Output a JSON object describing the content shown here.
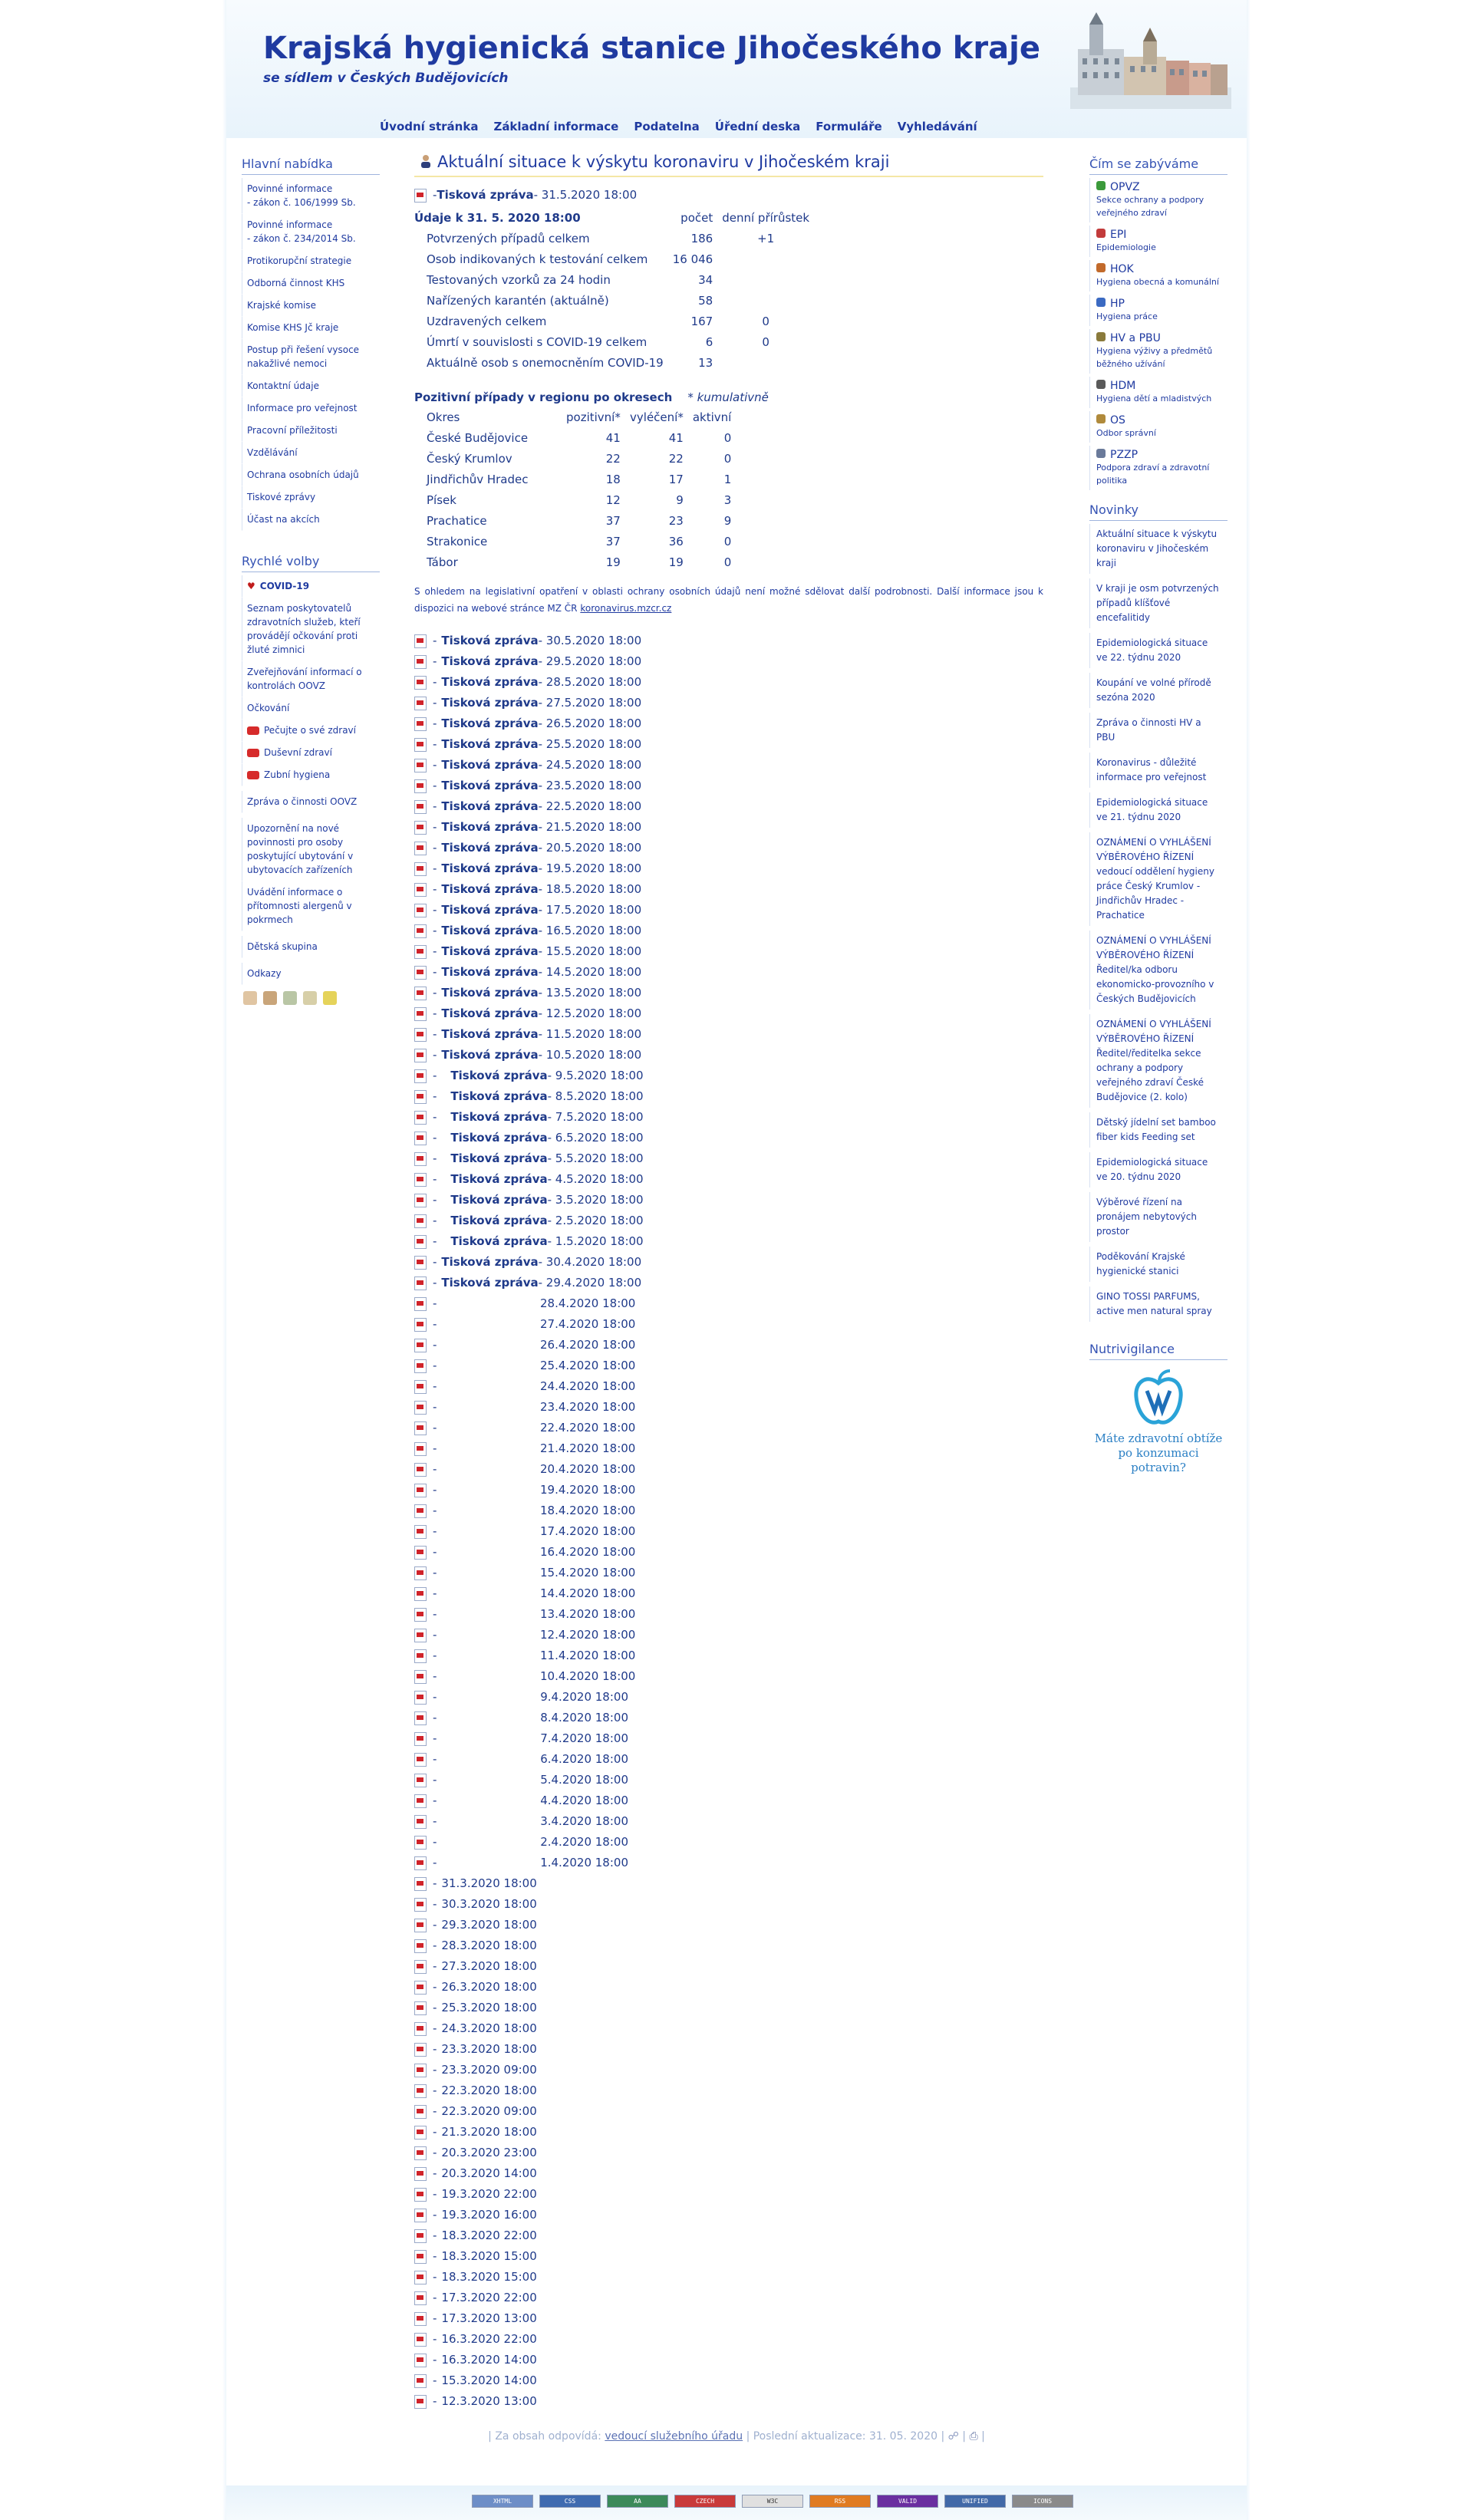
{
  "header": {
    "title": "Krajská hygienická stanice Jihočeského kraje",
    "subtitle": "se sídlem v Českých Budějovicích"
  },
  "topnav": [
    {
      "label": "Úvodní stránka"
    },
    {
      "label": "Základní informace"
    },
    {
      "label": "Podatelna"
    },
    {
      "label": "Úřední deska"
    },
    {
      "label": "Formuláře"
    },
    {
      "label": "Vyhledávání"
    }
  ],
  "left": {
    "main_menu_title": "Hlavní nabídka",
    "main_menu": [
      {
        "label": "Povinné informace\n- zákon č. 106/1999 Sb."
      },
      {
        "label": "Povinné informace\n- zákon č. 234/2014 Sb."
      },
      {
        "label": "Protikorupční strategie"
      },
      {
        "label": "Odborná činnost KHS"
      },
      {
        "label": "Krajské komise"
      },
      {
        "label": "Komise KHS Jč kraje"
      },
      {
        "label": "Postup při řešení vysoce nakažlivé nemoci"
      },
      {
        "label": "Kontaktní údaje"
      },
      {
        "label": "Informace pro veřejnost"
      },
      {
        "label": "Pracovní příležitosti"
      },
      {
        "label": "Vzdělávání"
      },
      {
        "label": "Ochrana osobních údajů"
      },
      {
        "label": "Tiskové zprávy"
      },
      {
        "label": "Účast na akcích"
      }
    ],
    "quick_title": "Rychlé volby",
    "quick": [
      {
        "label": "COVID-19",
        "kind": "covid"
      },
      {
        "label": "Seznam poskytovatelů zdravotních služeb, kteří provádějí očkování proti žluté zimnici"
      },
      {
        "label": "Zveřejňování informací o kontrolách OOVZ"
      },
      {
        "label": "Očkování"
      },
      {
        "label": "Pečujte o své zdraví",
        "kind": "video"
      },
      {
        "label": "Duševní zdraví",
        "kind": "video"
      },
      {
        "label": "Zubní hygiena",
        "kind": "video"
      },
      {
        "label": "Zpráva o činnosti OOVZ"
      },
      {
        "label": "Upozornění na nové povinnosti pro osoby poskytující ubytování v ubytovacích zařízeních"
      },
      {
        "label": "Uvádění informace o přítomnosti alergenů v pokrmech"
      },
      {
        "label": "Dětská skupina"
      },
      {
        "label": "Odkazy"
      }
    ]
  },
  "main": {
    "title": "Aktuální situace k výskytu koronaviru v Jihočeském kraji",
    "press_label": "Tisková zpráva",
    "first_row": {
      "prefix": "- ",
      "label": "Tisková zpráva",
      "date": " - 31.5.2020 18:00"
    },
    "stats_header": {
      "label": "Údaje k 31. 5. 2020 18:00",
      "col1": "počet",
      "col2": "denní přírůstek"
    },
    "stats": [
      {
        "label": "Potvrzených případů celkem",
        "count": "186",
        "delta": "+1"
      },
      {
        "label": "Osob indikovaných k testování celkem",
        "count": "16 046",
        "delta": ""
      },
      {
        "label": "Testovaných vzorků za 24 hodin",
        "count": "34",
        "delta": ""
      },
      {
        "label": "Nařízených karantén (aktuálně)",
        "count": "58",
        "delta": ""
      },
      {
        "label": "Uzdravených celkem",
        "count": "167",
        "delta": "0"
      },
      {
        "label": "Úmrtí v souvislosti s COVID-19 celkem",
        "count": "6",
        "delta": "0"
      },
      {
        "label": "Aktuálně osob s onemocněním COVID-19",
        "count": "13",
        "delta": ""
      }
    ],
    "districts_title": "Pozitivní případy v regionu po okresech",
    "districts_note": "* kumulativně",
    "districts_header": {
      "name": "Okres",
      "pos": "pozitivní*",
      "heal": "vyléčení*",
      "act": "aktivní"
    },
    "districts": [
      {
        "name": "České Budějovice",
        "pos": "41",
        "heal": "41",
        "act": "0"
      },
      {
        "name": "Český Krumlov",
        "pos": "22",
        "heal": "22",
        "act": "0"
      },
      {
        "name": "Jindřichův Hradec",
        "pos": "18",
        "heal": "17",
        "act": "1"
      },
      {
        "name": "Písek",
        "pos": "12",
        "heal": "9",
        "act": "3"
      },
      {
        "name": "Prachatice",
        "pos": "37",
        "heal": "23",
        "act": "9"
      },
      {
        "name": "Strakonice",
        "pos": "37",
        "heal": "36",
        "act": "0"
      },
      {
        "name": "Tábor",
        "pos": "19",
        "heal": "19",
        "act": "0"
      }
    ],
    "note_text": "S ohledem na legislativní opatření v oblasti ochrany osobních údajů není možné sdělovat další podrobnosti. Další informace jsou k dispozici na webové stránce MZ ČR ",
    "note_link": "koronavirus.mzcr.cz",
    "press_rows": [
      {
        "date": " - 30.5.2020 18:00"
      },
      {
        "date": " - 29.5.2020 18:00"
      },
      {
        "date": " - 28.5.2020 18:00"
      },
      {
        "date": " - 27.5.2020 18:00"
      },
      {
        "date": " - 26.5.2020 18:00"
      },
      {
        "date": " - 25.5.2020 18:00"
      },
      {
        "date": " - 24.5.2020 18:00"
      },
      {
        "date": " - 23.5.2020 18:00"
      },
      {
        "date": " - 22.5.2020 18:00"
      },
      {
        "date": " - 21.5.2020 18:00"
      },
      {
        "date": " - 20.5.2020 18:00"
      },
      {
        "date": " - 19.5.2020 18:00"
      },
      {
        "date": " - 18.5.2020 18:00"
      },
      {
        "date": " - 17.5.2020 18:00"
      },
      {
        "date": " - 16.5.2020 18:00"
      },
      {
        "date": " - 15.5.2020 18:00"
      },
      {
        "date": " - 14.5.2020 18:00"
      },
      {
        "date": " - 13.5.2020 18:00"
      },
      {
        "date": " - 12.5.2020 18:00"
      },
      {
        "date": " - 11.5.2020 18:00"
      },
      {
        "date": " - 10.5.2020 18:00"
      }
    ],
    "press_rows_indented": [
      {
        "date": " - 9.5.2020 18:00"
      },
      {
        "date": " - 8.5.2020 18:00"
      },
      {
        "date": " - 7.5.2020 18:00"
      },
      {
        "date": " - 6.5.2020 18:00"
      },
      {
        "date": " - 5.5.2020 18:00"
      },
      {
        "date": " - 4.5.2020 18:00"
      },
      {
        "date": " - 3.5.2020 18:00"
      },
      {
        "date": " - 2.5.2020 18:00"
      },
      {
        "date": " - 1.5.2020 18:00"
      }
    ],
    "press_rows_plain": [
      {
        "date": " - 30.4.2020 18:00"
      },
      {
        "date": " - 29.4.2020 18:00"
      }
    ],
    "date_only_right": [
      "28.4.2020 18:00",
      "27.4.2020 18:00",
      "26.4.2020 18:00",
      "25.4.2020 18:00",
      "24.4.2020 18:00",
      "23.4.2020 18:00",
      "22.4.2020 18:00",
      "21.4.2020 18:00",
      "20.4.2020 18:00",
      "19.4.2020 18:00",
      "18.4.2020 18:00",
      "17.4.2020 18:00",
      "16.4.2020 18:00",
      "15.4.2020 18:00",
      "14.4.2020 18:00",
      "13.4.2020 18:00",
      "12.4.2020 18:00",
      "11.4.2020 18:00",
      "10.4.2020 18:00",
      "9.4.2020 18:00",
      "8.4.2020 18:00",
      "7.4.2020 18:00",
      "6.4.2020 18:00",
      "5.4.2020 18:00",
      "4.4.2020 18:00",
      "3.4.2020 18:00",
      "2.4.2020 18:00",
      "1.4.2020 18:00"
    ],
    "date_only_left": [
      "31.3.2020 18:00",
      "30.3.2020 18:00",
      "29.3.2020 18:00",
      "28.3.2020 18:00",
      "27.3.2020 18:00",
      "26.3.2020 18:00",
      "25.3.2020 18:00",
      "24.3.2020 18:00",
      "23.3.2020 18:00",
      "23.3.2020 09:00",
      "22.3.2020 18:00",
      "22.3.2020 09:00",
      "21.3.2020 18:00",
      "20.3.2020 23:00",
      "20.3.2020 14:00",
      "19.3.2020 22:00",
      "19.3.2020 16:00",
      "18.3.2020 22:00",
      "18.3.2020 15:00",
      "18.3.2020 15:00",
      "17.3.2020 22:00",
      "17.3.2020 13:00",
      "16.3.2020 22:00",
      "16.3.2020 14:00",
      "15.3.2020 14:00",
      "12.3.2020 13:00"
    ],
    "dash": "-"
  },
  "right": {
    "topics_title": "Čím se zabýváme",
    "topics": [
      {
        "name": "OPVZ",
        "desc": "Sekce ochrany a podpory veřejného zdraví"
      },
      {
        "name": "EPI",
        "desc": "Epidemiologie"
      },
      {
        "name": "HOK",
        "desc": "Hygiena obecná a komunální"
      },
      {
        "name": "HP",
        "desc": "Hygiena práce"
      },
      {
        "name": "HV a PBU",
        "desc": "Hygiena výživy a předmětů běžného užívání"
      },
      {
        "name": "HDM",
        "desc": "Hygiena dětí a mladistvých"
      },
      {
        "name": "OS",
        "desc": "Odbor správní"
      },
      {
        "name": "PZZP",
        "desc": "Podpora zdraví a zdravotní politika"
      }
    ],
    "news_title": "Novinky",
    "news": [
      "Aktuální situace k výskytu koronaviru v Jihočeském kraji",
      "V kraji je osm potvrzených případů klíšťové encefalitidy",
      "Epidemiologická situace ve 22. týdnu 2020",
      "Koupání ve volné přírodě sezóna 2020",
      "Zpráva o činnosti HV a PBU",
      "Koronavirus - důležité informace pro veřejnost",
      "Epidemiologická situace ve 21. týdnu 2020",
      "OZNÁMENÍ O VYHLÁŠENÍ VÝBĚROVÉHO ŘÍZENÍ vedoucí oddělení hygieny práce Český Krumlov - Jindřichův Hradec - Prachatice",
      "OZNÁMENÍ O VYHLÁŠENÍ VÝBĚROVÉHO ŘÍZENÍ Ředitel/ka odboru ekonomicko-provozního v Českých Budějovicích",
      "OZNÁMENÍ O VYHLÁŠENÍ VÝBĚROVÉHO ŘÍZENÍ Ředitel/ředitelka sekce ochrany a podpory veřejného zdraví České Budějovice (2. kolo)",
      "Dětský jídelní set bamboo fiber kids Feeding set",
      "Epidemiologická situace ve 20. týdnu 2020",
      "Výběrové řízení na pronájem nebytových prostor",
      "Poděkování Krajské hygienické stanici",
      "GINO TOSSI PARFUMS, active men natural spray"
    ],
    "nutri_title": "Nutrivigilance",
    "nutri_text": "Máte zdravotní obtíže po konzumaci potravin?"
  },
  "footer": {
    "prefix": "| Za obsah odpovídá: ",
    "link": "vedoucí služebního úřadu",
    "updated": " | Poslední aktualizace: 31. 05. 2020 | ",
    "end": " | ",
    "badges": [
      "XHTML",
      "CSS",
      "AA",
      "CZECH",
      "W3C",
      "RSS",
      "VALID",
      "UNIFIED",
      "ICONS"
    ]
  },
  "colors": {
    "accent": "#1f3aa0",
    "pdf_red": "#d0232a",
    "light_bg": "#eef6fc"
  }
}
